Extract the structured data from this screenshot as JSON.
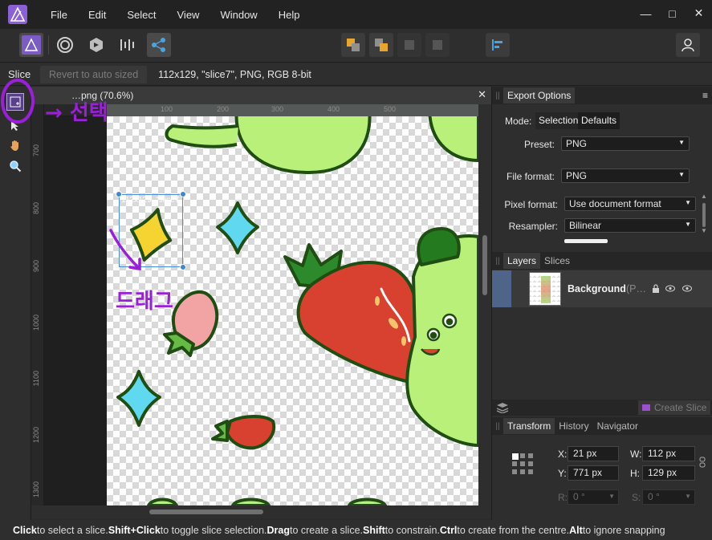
{
  "menubar": {
    "items": [
      "File",
      "Edit",
      "Select",
      "View",
      "Window",
      "Help"
    ]
  },
  "window_controls": [
    "—",
    "□",
    "✕"
  ],
  "context": {
    "tool_name": "Slice",
    "revert_label": "Revert to auto sized",
    "selection_info": "112x129, \"slice7\", PNG, RGB 8-bit"
  },
  "document": {
    "title": "…png (70.6%)",
    "close": "✕",
    "ruler_h_labels": [
      "100",
      "200",
      "300",
      "400",
      "500"
    ],
    "ruler_unit": "px",
    "ruler_v_labels": [
      "700",
      "800",
      "900",
      "1000",
      "1100",
      "1200",
      "1300"
    ]
  },
  "slice": {
    "label": "112x129, \"slice7"
  },
  "export_options": {
    "tab_label": "Export Options",
    "menu": "≡",
    "mode_label": "Mode:",
    "mode_selection": "Selection",
    "mode_defaults": "Defaults",
    "preset_label": "Preset:",
    "preset_value": "PNG",
    "file_format_label": "File format:",
    "file_format_value": "PNG",
    "pixel_format_label": "Pixel format:",
    "pixel_format_value": "Use document format",
    "resampler_label": "Resampler:",
    "resampler_value": "Bilinear"
  },
  "layers": {
    "tabs": [
      "Layers",
      "Slices"
    ],
    "items": [
      {
        "name": "Background",
        "suffix": "(P…"
      }
    ]
  },
  "create_slice_label": "Create Slice",
  "transform": {
    "tabs": [
      "Transform",
      "History",
      "Navigator"
    ],
    "x_label": "X:",
    "x_value": "21 px",
    "y_label": "Y:",
    "y_value": "771 px",
    "w_label": "W:",
    "w_value": "112 px",
    "h_label": "H:",
    "h_value": "129 px",
    "r_label": "R:",
    "r_value": "0 °",
    "s_label": "S:",
    "s_value": "0 °"
  },
  "status": {
    "k1": "Click",
    "t1": " to select a slice. ",
    "k2": "Shift+Click",
    "t2": " to toggle slice selection. ",
    "k3": "Drag",
    "t3": " to create a slice. ",
    "k4": "Shift",
    "t4": " to constrain. ",
    "k5": "Ctrl",
    "t5": " to create from the centre. ",
    "k6": "Alt",
    "t6": " to ignore snapping"
  },
  "annotations": {
    "select_note": "→ 선택",
    "drag_note": "드래그"
  },
  "colors": {
    "accent": "#4a90d9",
    "annotation": "#9b1fd8",
    "mascot": "#b8f07a",
    "strawberry": "#d8402f"
  }
}
